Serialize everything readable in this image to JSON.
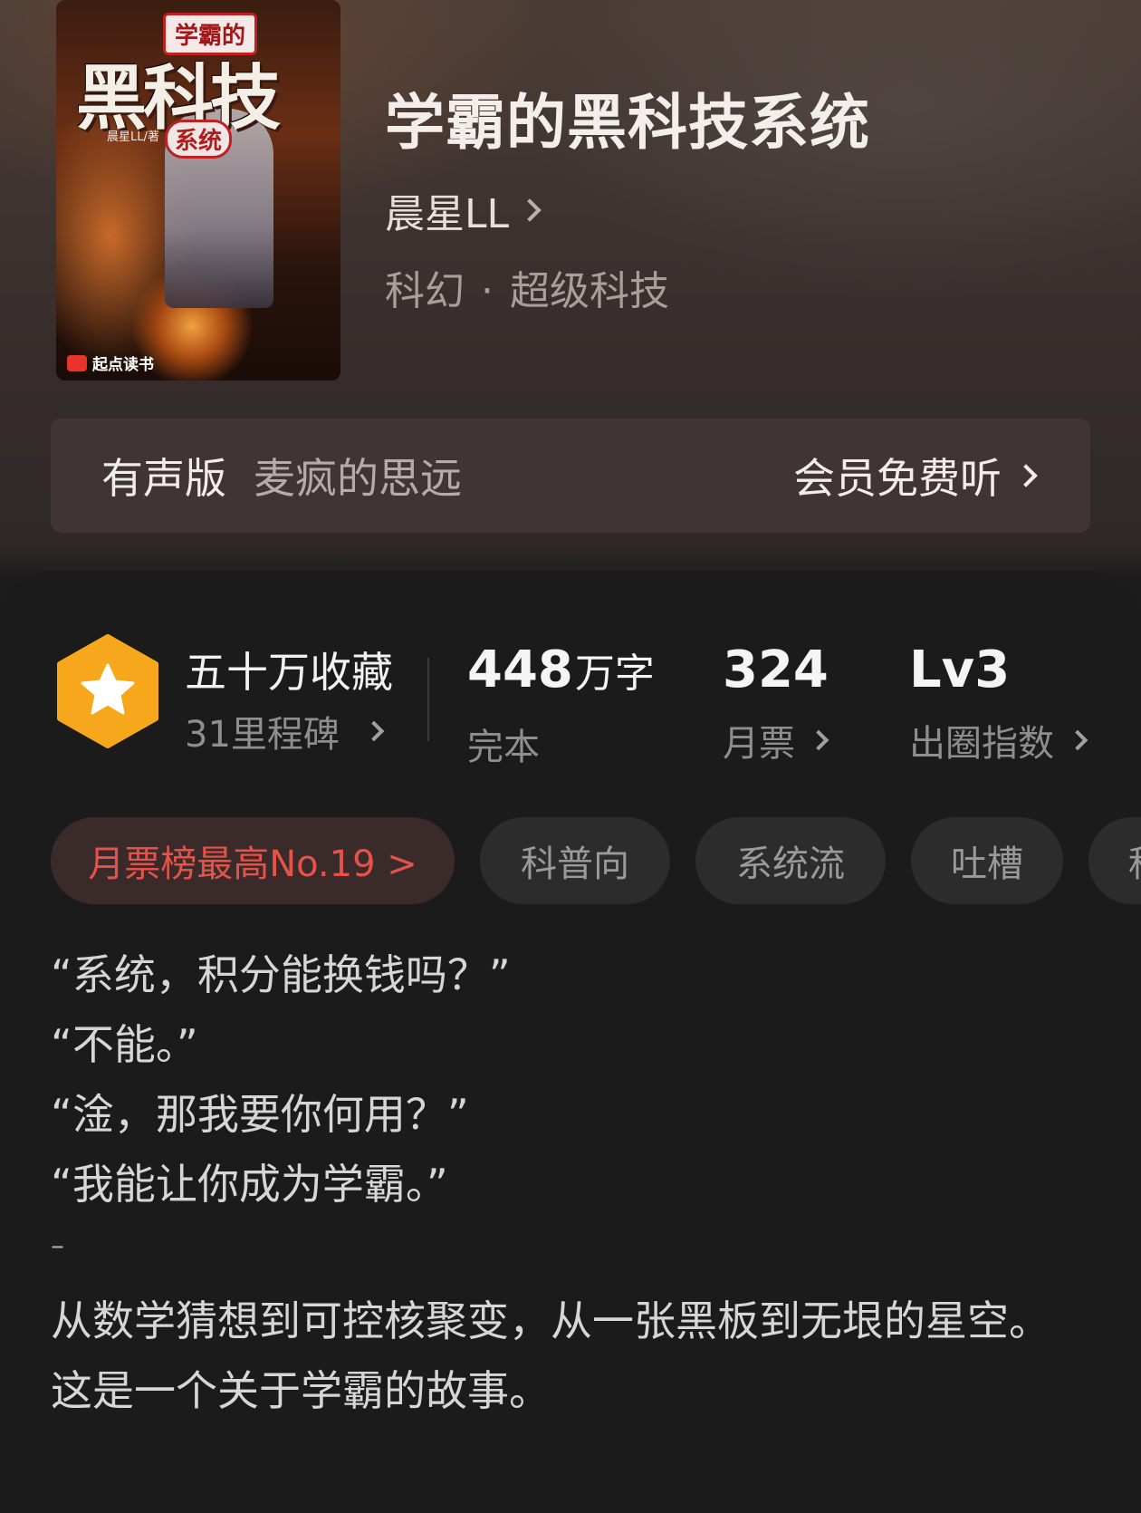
{
  "book": {
    "title": "学霸的黑科技系统",
    "author": "晨星LL",
    "genre": "科幻",
    "subgenre": "超级科技",
    "genre_separator": "·"
  },
  "cover": {
    "badge_top": "学霸的",
    "title_main": "黑科技",
    "badge_sub": "系统",
    "author_line": "晨星LL/著",
    "publisher": "起点读书"
  },
  "audio": {
    "label": "有声版",
    "narrator": "麦疯的思远",
    "cta": "会员免费听"
  },
  "stats": {
    "collect_title": "五十万收藏",
    "collect_sub": "31里程碑",
    "words_value": "448",
    "words_unit": "万字",
    "words_label": "完本",
    "votes_value": "324",
    "votes_label": "月票",
    "level_value": "Lv3",
    "level_label": "出圈指数"
  },
  "tags": [
    "月票榜最高No.19 >",
    "科普向",
    "系统流",
    "吐槽",
    "科"
  ],
  "description": {
    "lines": [
      "“系统，积分能换钱吗？”",
      "“不能。”",
      "“淦，那我要你何用？”",
      "“我能让你成为学霸。”"
    ],
    "dash": "–",
    "paragraph1": "从数学猜想到可控核聚变，从一张黑板到无垠的星空。",
    "paragraph2": "这是一个关于学霸的故事。"
  },
  "colors": {
    "accent_red": "#e4534a",
    "badge_orange": "#f6a71c",
    "panel_bg": "#1b1b1b"
  }
}
